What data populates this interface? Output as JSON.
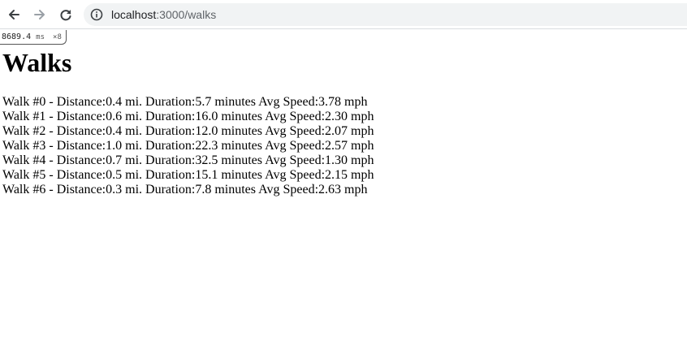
{
  "browser": {
    "back_icon": "arrow-left-icon",
    "forward_icon": "arrow-right-icon",
    "reload_icon": "reload-icon",
    "info_icon": "info-circle-icon",
    "url_host": "localhost",
    "url_rest": ":3000/walks"
  },
  "perf": {
    "value": "8689.4",
    "unit": "ms",
    "multiplier": "×8"
  },
  "page": {
    "title": "Walks"
  },
  "walks": [
    "Walk #0 - Distance:0.4 mi. Duration:5.7 minutes Avg Speed:3.78 mph",
    "Walk #1 - Distance:0.6 mi. Duration:16.0 minutes Avg Speed:2.30 mph",
    "Walk #2 - Distance:0.4 mi. Duration:12.0 minutes Avg Speed:2.07 mph",
    "Walk #3 - Distance:1.0 mi. Duration:22.3 minutes Avg Speed:2.57 mph",
    "Walk #4 - Distance:0.7 mi. Duration:32.5 minutes Avg Speed:1.30 mph",
    "Walk #5 - Distance:0.5 mi. Duration:15.1 minutes Avg Speed:2.15 mph",
    "Walk #6 - Distance:0.3 mi. Duration:7.8 minutes Avg Speed:2.63 mph"
  ]
}
